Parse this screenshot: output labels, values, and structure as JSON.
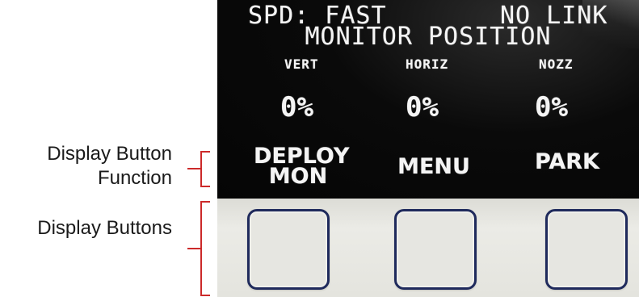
{
  "annotations": {
    "display_button_function": "Display Button\nFunction",
    "display_buttons": "Display Buttons"
  },
  "display": {
    "speed": "SPD: FAST",
    "link_status": "NO LINK",
    "title": "MONITOR POSITION",
    "columns": [
      {
        "header": "VERT",
        "value": "0%"
      },
      {
        "header": "HORIZ",
        "value": "0%"
      },
      {
        "header": "NOZZ",
        "value": "0%"
      }
    ],
    "functions": [
      "DEPLOY\nMON",
      "MENU",
      "PARK"
    ]
  },
  "colors": {
    "bracket": "#cc2a2a",
    "button_border": "#1f2a5c"
  }
}
